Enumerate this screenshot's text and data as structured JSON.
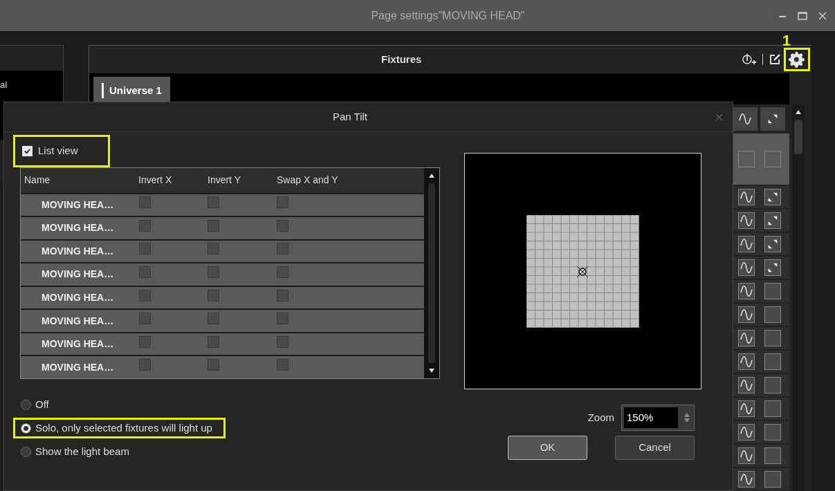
{
  "window": {
    "title": "Page settings\"MOVING HEAD\""
  },
  "left_panel": {
    "text": "al"
  },
  "fixtures_panel": {
    "title": "Fixtures",
    "annotation": "1",
    "tabs": [
      {
        "label": "Universe 1",
        "selected": true
      }
    ],
    "right_column": {
      "rows": [
        {
          "kind": "arrows"
        },
        {
          "kind": "arrows"
        },
        {
          "kind": "arrows"
        },
        {
          "kind": "arrows"
        },
        {
          "kind": "empty"
        },
        {
          "kind": "empty"
        },
        {
          "kind": "empty"
        },
        {
          "kind": "empty"
        },
        {
          "kind": "empty"
        },
        {
          "kind": "empty"
        },
        {
          "kind": "empty"
        },
        {
          "kind": "empty"
        },
        {
          "kind": "empty"
        }
      ]
    }
  },
  "dialog": {
    "title": "Pan Tilt",
    "list_view": {
      "label": "List view",
      "checked": true
    },
    "table": {
      "columns": [
        "Name",
        "Invert X",
        "Invert Y",
        "Swap X and Y"
      ],
      "rows": [
        {
          "name": "MOVING HEA…",
          "invert_x": false,
          "invert_y": false,
          "swap": false
        },
        {
          "name": "MOVING HEA…",
          "invert_x": false,
          "invert_y": false,
          "swap": false
        },
        {
          "name": "MOVING HEA…",
          "invert_x": false,
          "invert_y": false,
          "swap": false
        },
        {
          "name": "MOVING HEA…",
          "invert_x": false,
          "invert_y": false,
          "swap": false
        },
        {
          "name": "MOVING HEA…",
          "invert_x": false,
          "invert_y": false,
          "swap": false
        },
        {
          "name": "MOVING HEA…",
          "invert_x": false,
          "invert_y": false,
          "swap": false
        },
        {
          "name": "MOVING HEA…",
          "invert_x": false,
          "invert_y": false,
          "swap": false
        },
        {
          "name": "MOVING HEA…",
          "invert_x": false,
          "invert_y": false,
          "swap": false
        }
      ]
    },
    "modes": [
      {
        "label": "Off",
        "selected": false,
        "highlighted": false
      },
      {
        "label": "Solo, only selected fixtures will light up",
        "selected": true,
        "highlighted": true
      },
      {
        "label": "Show the light beam",
        "selected": false,
        "highlighted": false
      }
    ],
    "zoom": {
      "label": "Zoom",
      "value": "150%"
    },
    "buttons": [
      "OK",
      "Cancel"
    ]
  }
}
